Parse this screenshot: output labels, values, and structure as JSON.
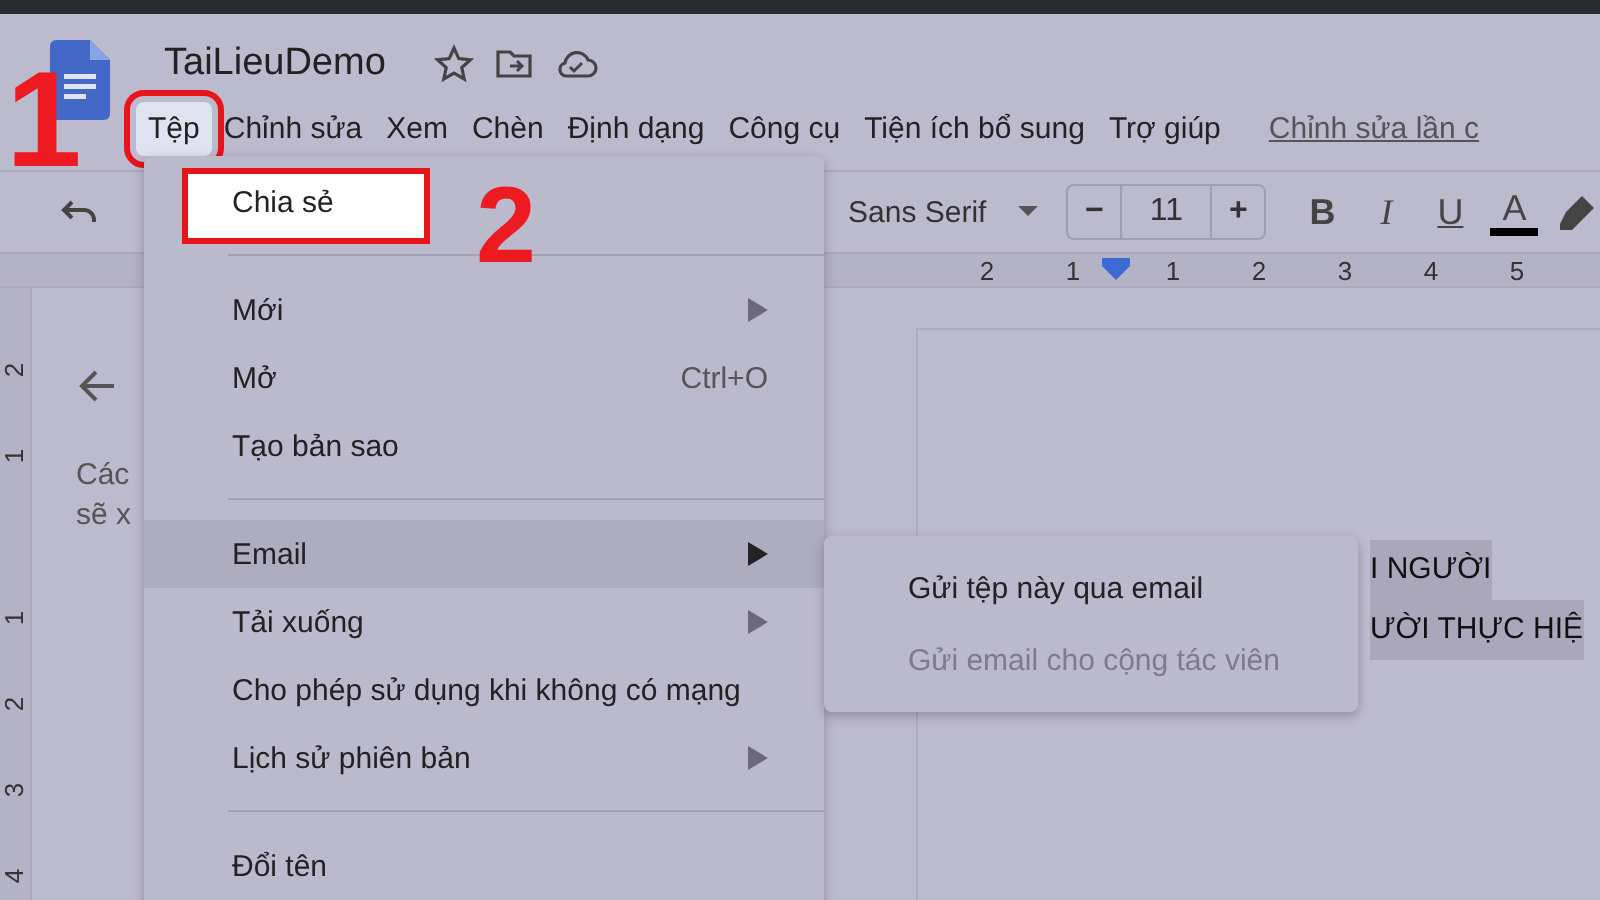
{
  "document": {
    "title": "TaiLieuDemo"
  },
  "menu_bar": [
    {
      "label": "Tệp",
      "selected": true,
      "outlined": true
    },
    {
      "label": "Chỉnh sửa",
      "selected": false,
      "outlined": false
    },
    {
      "label": "Xem",
      "selected": false,
      "outlined": false
    },
    {
      "label": "Chèn",
      "selected": false,
      "outlined": false
    },
    {
      "label": "Định dạng",
      "selected": false,
      "outlined": false
    },
    {
      "label": "Công cụ",
      "selected": false,
      "outlined": false
    },
    {
      "label": "Tiện ích bổ sung",
      "selected": false,
      "outlined": false
    },
    {
      "label": "Trợ giúp",
      "selected": false,
      "outlined": false
    }
  ],
  "last_edit_link": "Chỉnh sửa lần c",
  "toolbar": {
    "font": "Sans Serif",
    "decrease": "−",
    "font_size": "11",
    "increase": "+",
    "format_buttons": [
      {
        "label": "B",
        "kind": "bold"
      },
      {
        "label": "I",
        "kind": "italic"
      },
      {
        "label": "U",
        "kind": "underline"
      },
      {
        "label": "A",
        "kind": "color"
      }
    ]
  },
  "ruler": {
    "labels": [
      "2",
      "1",
      "1",
      "2",
      "3",
      "4",
      "5"
    ]
  },
  "vertical_ruler": {
    "labels": [
      "2",
      "1",
      "1",
      "2",
      "3",
      "4"
    ]
  },
  "sidebar": {
    "lines": [
      "Các",
      "sẽ x"
    ]
  },
  "page_text": [
    "I NGƯỜI",
    "ƯỜI THỰC HIỆ"
  ],
  "file_menu": {
    "items": [
      {
        "kind": "item",
        "label": "Chia sẻ",
        "selected": false,
        "submenu": false,
        "outlined": true
      },
      {
        "kind": "divider"
      },
      {
        "kind": "item",
        "label": "Mới",
        "selected": false,
        "submenu": true,
        "outlined": false
      },
      {
        "kind": "item",
        "label": "Mở",
        "shortcut": "Ctrl+O",
        "selected": false,
        "submenu": false,
        "outlined": false
      },
      {
        "kind": "item",
        "label": "Tạo bản sao",
        "selected": false,
        "submenu": false,
        "outlined": false
      },
      {
        "kind": "divider"
      },
      {
        "kind": "item",
        "label": "Email",
        "selected": true,
        "submenu": true,
        "outlined": false
      },
      {
        "kind": "item",
        "label": "Tải xuống",
        "selected": false,
        "submenu": true,
        "outlined": false
      },
      {
        "kind": "item",
        "label": "Cho phép sử dụng khi không có mạng",
        "selected": false,
        "submenu": false,
        "outlined": false
      },
      {
        "kind": "item",
        "label": "Lịch sử phiên bản",
        "selected": false,
        "submenu": true,
        "outlined": false
      },
      {
        "kind": "divider"
      },
      {
        "kind": "item",
        "label": "Đổi tên",
        "selected": false,
        "submenu": false,
        "outlined": false
      }
    ]
  },
  "email_submenu": {
    "items": [
      {
        "label": "Gửi tệp này qua email",
        "disabled": false
      },
      {
        "label": "Gửi email cho cộng tác viên",
        "disabled": true
      }
    ]
  },
  "annotations": [
    {
      "label": "1",
      "kind": "step"
    },
    {
      "label": "2",
      "kind": "step"
    }
  ]
}
